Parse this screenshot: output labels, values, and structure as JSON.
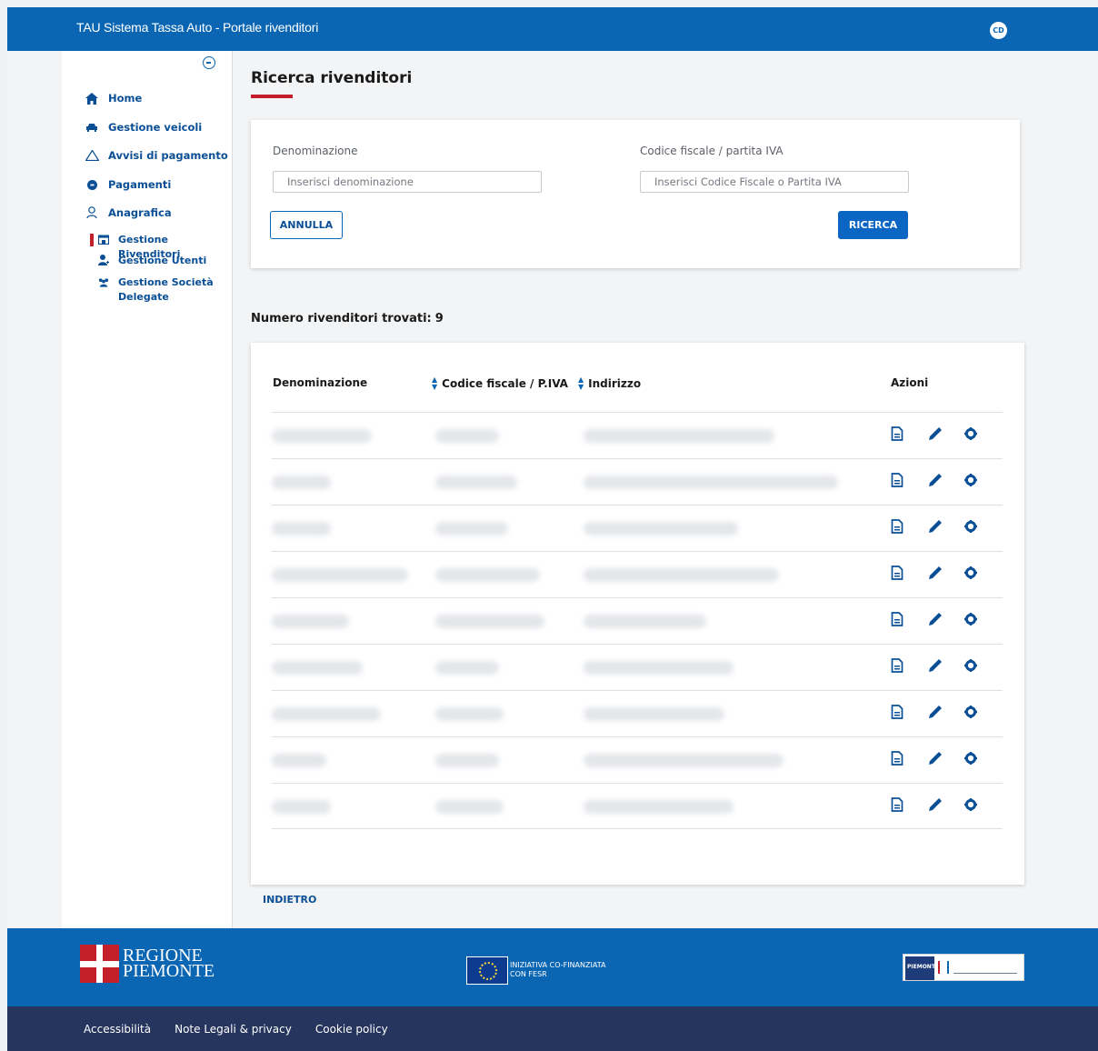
{
  "header": {
    "title": "TAU Sistema Tassa Auto - Portale rivenditori",
    "avatar_initials": "CD"
  },
  "sidebar": {
    "items": [
      {
        "label": "Home",
        "icon": "home-icon"
      },
      {
        "label": "Gestione veicoli",
        "icon": "car-icon"
      },
      {
        "label": "Avvisi di pagamento",
        "icon": "warning-icon"
      },
      {
        "label": "Pagamenti",
        "icon": "euro-icon"
      },
      {
        "label": "Anagrafica",
        "icon": "user-icon"
      }
    ],
    "subitems": [
      {
        "label": "Gestione Rivenditori",
        "icon": "store-icon",
        "active": true
      },
      {
        "label": "Gestione Utenti",
        "icon": "user-add-icon",
        "active": false
      },
      {
        "label": "Gestione Società Delegate",
        "icon": "group-icon",
        "active": false
      }
    ]
  },
  "page": {
    "title": "Ricerca rivenditori",
    "accent_color": "#c41e2a"
  },
  "search": {
    "denominazione_label": "Denominazione",
    "denominazione_placeholder": "Inserisci denominazione",
    "denominazione_value": "",
    "cf_label": "Codice fiscale / partita IVA",
    "cf_placeholder": "Inserisci Codice Fiscale o Partita IVA",
    "cf_value": "",
    "cancel_label": "ANNULLA",
    "search_label": "RICERCA"
  },
  "results": {
    "count_label": "Numero rivenditori trovati:",
    "count": "9",
    "columns": [
      "Denominazione",
      "Codice fiscale / P.IVA",
      "Indirizzo",
      "Azioni"
    ],
    "row_count": 9,
    "actions": [
      "document-icon",
      "pencil-icon",
      "gear-icon"
    ]
  },
  "back_label": "INDIETRO",
  "footer": {
    "region_logo_line1": "REGIONE",
    "region_logo_line2": "PIEMONTE",
    "eu_line1": "INIZIATIVA CO-FINANZIATA",
    "eu_line2": "CON FESR",
    "partner_logo_text": "PIEMONTE",
    "links": [
      "Accessibilità",
      "Note Legali & privacy",
      "Cookie policy"
    ]
  },
  "colors": {
    "primary": "#0a66b3",
    "footer_dark": "#26355e"
  }
}
